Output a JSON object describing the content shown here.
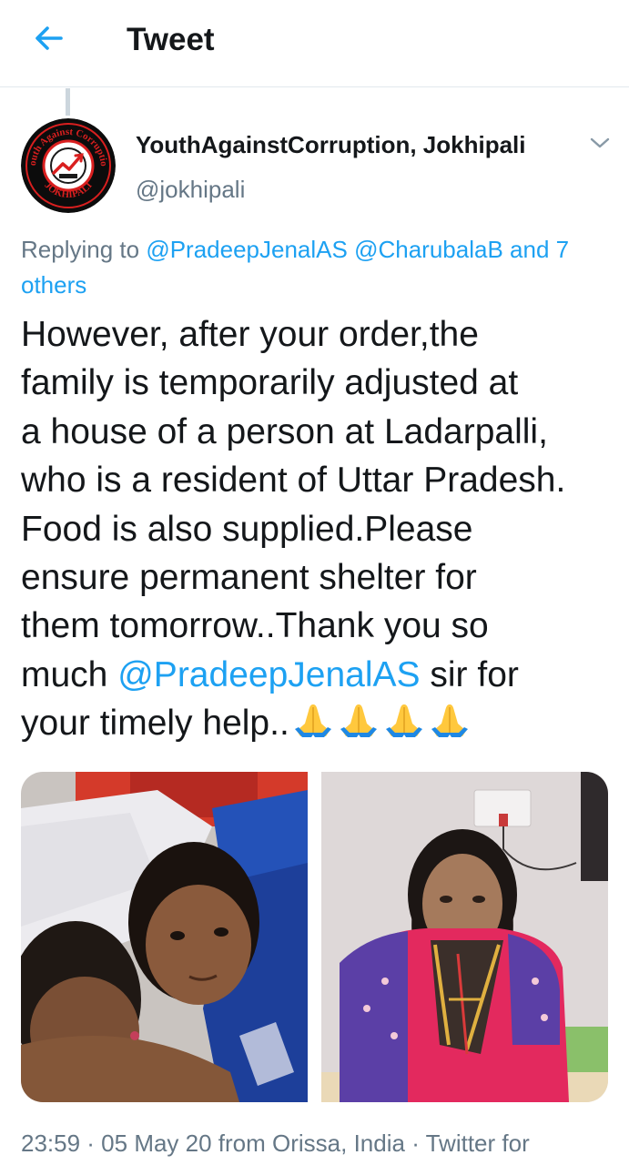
{
  "header": {
    "title": "Tweet"
  },
  "author": {
    "display_name": "YouthAgainstCorruption, Jokhipali",
    "handle": "@jokhipali",
    "avatar_ring_text": "Youth Against Corruption",
    "avatar_bottom_text": "JOKHIPALI"
  },
  "reply": {
    "prefix": "Replying to",
    "mention_1": "@PradeepJenalAS",
    "mention_2": "@CharubalaB",
    "others": "and 7 others"
  },
  "tweet": {
    "line_1": "However, after your order,the",
    "line_2": "family is temporarily adjusted at",
    "line_3": "a house of a person at Ladarpalli,",
    "line_4": "who is a resident of Uttar Pradesh.",
    "line_5": "Food is also supplied.Please",
    "line_6": "ensure permanent shelter for",
    "line_7": "them tomorrow..Thank you so",
    "line_8_prefix": "much",
    "line_8_mention": "@PradeepJenalAS",
    "line_8_suffix": "sir for",
    "line_9": "your timely help.."
  },
  "meta": {
    "text": "23:59 · 05 May 20 from Orissa, India · Twitter for"
  },
  "colors": {
    "link": "#1da1f2",
    "secondary_text": "#657786",
    "primary_text": "#14171a"
  },
  "icons": {
    "back": "arrow-left-icon",
    "menu": "chevron-down-icon",
    "emoji": "folded-hands-emoji"
  }
}
